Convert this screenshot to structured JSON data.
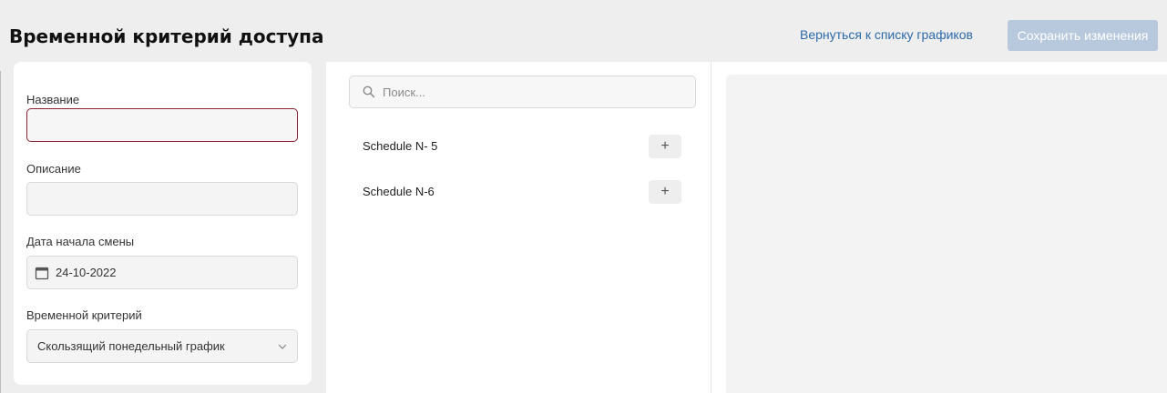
{
  "header": {
    "title": "Временной критерий доступа",
    "back_link": "Вернуться к списку графиков",
    "save_button": "Сохранить изменения"
  },
  "form": {
    "name_label": "Название",
    "name_value": "",
    "description_label": "Описание",
    "description_value": "",
    "start_date_label": "Дата начала смены",
    "start_date_value": "24-10-2022",
    "criterion_label": "Временной критерий",
    "criterion_value": "Скользящий понедельный график"
  },
  "list": {
    "search_placeholder": "Поиск...",
    "items": [
      {
        "label": "Schedule N- 5",
        "add_label": "+"
      },
      {
        "label": "Schedule N-6",
        "add_label": "+"
      }
    ]
  },
  "colors": {
    "accent_link": "#2d6aa9",
    "save_disabled": "#b8c9de",
    "error_border": "#8b2131"
  }
}
